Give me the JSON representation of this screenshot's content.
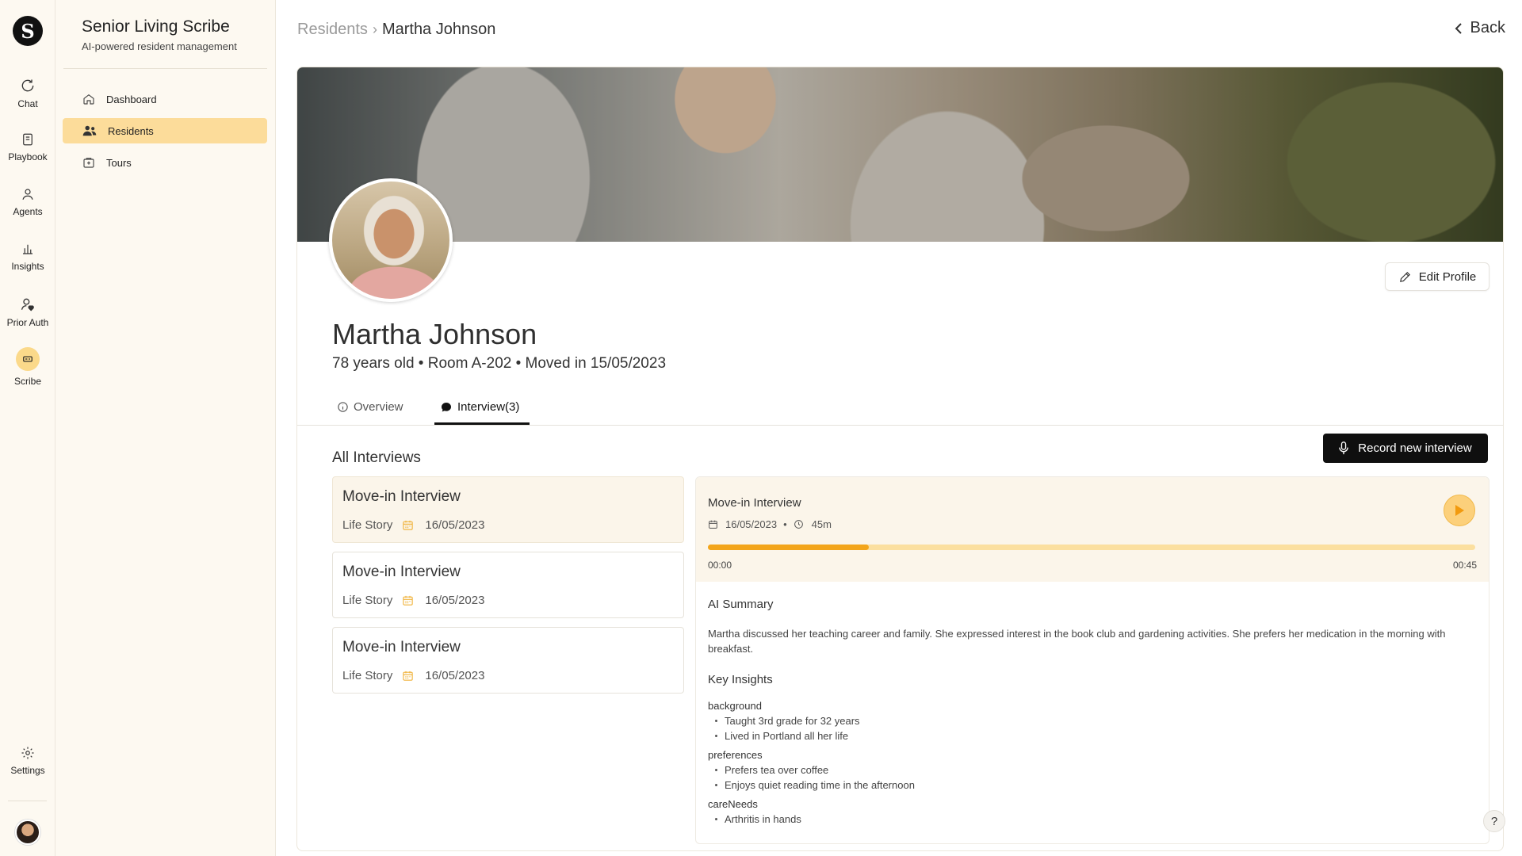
{
  "rail": {
    "logo_letter": "S",
    "items": [
      {
        "label": "Chat",
        "icon": "chat-icon"
      },
      {
        "label": "Playbook",
        "icon": "playbook-icon"
      },
      {
        "label": "Agents",
        "icon": "agents-icon"
      },
      {
        "label": "Insights",
        "icon": "insights-icon"
      },
      {
        "label": "Prior Auth",
        "icon": "prior-auth-icon"
      },
      {
        "label": "Scribe",
        "icon": "scribe-icon"
      }
    ],
    "active": "Scribe",
    "settings_label": "Settings"
  },
  "sidebar": {
    "title": "Senior Living Scribe",
    "subtitle": "AI-powered resident management",
    "items": [
      {
        "label": "Dashboard",
        "icon": "home-icon"
      },
      {
        "label": "Residents",
        "icon": "users-icon"
      },
      {
        "label": "Tours",
        "icon": "tours-icon"
      }
    ],
    "active": "Residents"
  },
  "header": {
    "breadcrumb": [
      "Residents",
      "Martha Johnson"
    ],
    "back_label": "Back"
  },
  "profile": {
    "name": "Martha Johnson",
    "meta": "78 years old • Room A-202 • Moved in 15/05/2023",
    "edit_label": "Edit Profile"
  },
  "tabs": [
    {
      "label": "Overview",
      "icon": "info-icon"
    },
    {
      "label": "Interview(3)",
      "icon": "chat-bubble-icon"
    }
  ],
  "active_tab": "Interview(3)",
  "interviews": {
    "section_title": "All Interviews",
    "record_label": "Record new interview",
    "list": [
      {
        "title": "Move-in Interview",
        "category": "Life Story",
        "date": "16/05/2023"
      },
      {
        "title": "Move-in Interview",
        "category": "Life Story",
        "date": "16/05/2023"
      },
      {
        "title": "Move-in Interview",
        "category": "Life Story",
        "date": "16/05/2023"
      }
    ],
    "selected_index": 0
  },
  "detail": {
    "title": "Move-in Interview",
    "date": "16/05/2023",
    "duration": "45m",
    "time_start": "00:00",
    "time_end": "00:45",
    "progress": 0.21,
    "summary_heading": "AI Summary",
    "summary": "Martha discussed her teaching career and family. She expressed interest in the book club and gardening activities. She prefers her medication in the morning with breakfast.",
    "insights_heading": "Key Insights",
    "insight_groups": [
      {
        "label": "background",
        "items": [
          "Taught 3rd grade for 32 years",
          "Lived in Portland all her life"
        ]
      },
      {
        "label": "preferences",
        "items": [
          "Prefers tea over coffee",
          "Enjoys quiet reading time in the afternoon"
        ]
      },
      {
        "label": "careNeeds",
        "items": [
          "Arthritis in hands"
        ]
      }
    ]
  },
  "help_label": "?",
  "colors": {
    "accent": "#fcdc9a",
    "progress": "#f3a51b",
    "button_dark": "#0f0f0f"
  }
}
